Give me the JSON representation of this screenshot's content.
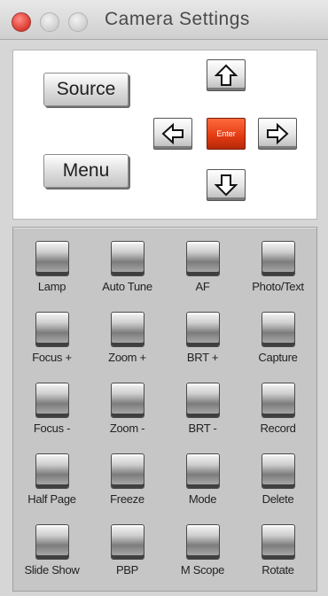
{
  "window": {
    "title": "Camera Settings"
  },
  "controls": {
    "source_label": "Source",
    "menu_label": "Menu",
    "enter_label": "Enter"
  },
  "keys": [
    "Lamp",
    "Auto Tune",
    "AF",
    "Photo/Text",
    "Focus +",
    "Zoom +",
    "BRT +",
    "Capture",
    "Focus -",
    "Zoom -",
    "BRT -",
    "Record",
    "Half Page",
    "Freeze",
    "Mode",
    "Delete",
    "Slide Show",
    "PBP",
    "M Scope",
    "Rotate"
  ],
  "colors": {
    "enter": "#e23a12",
    "close": "#e0443a"
  },
  "icons": {
    "up": "arrow-up-icon",
    "down": "arrow-down-icon",
    "left": "arrow-left-icon",
    "right": "arrow-right-icon"
  }
}
